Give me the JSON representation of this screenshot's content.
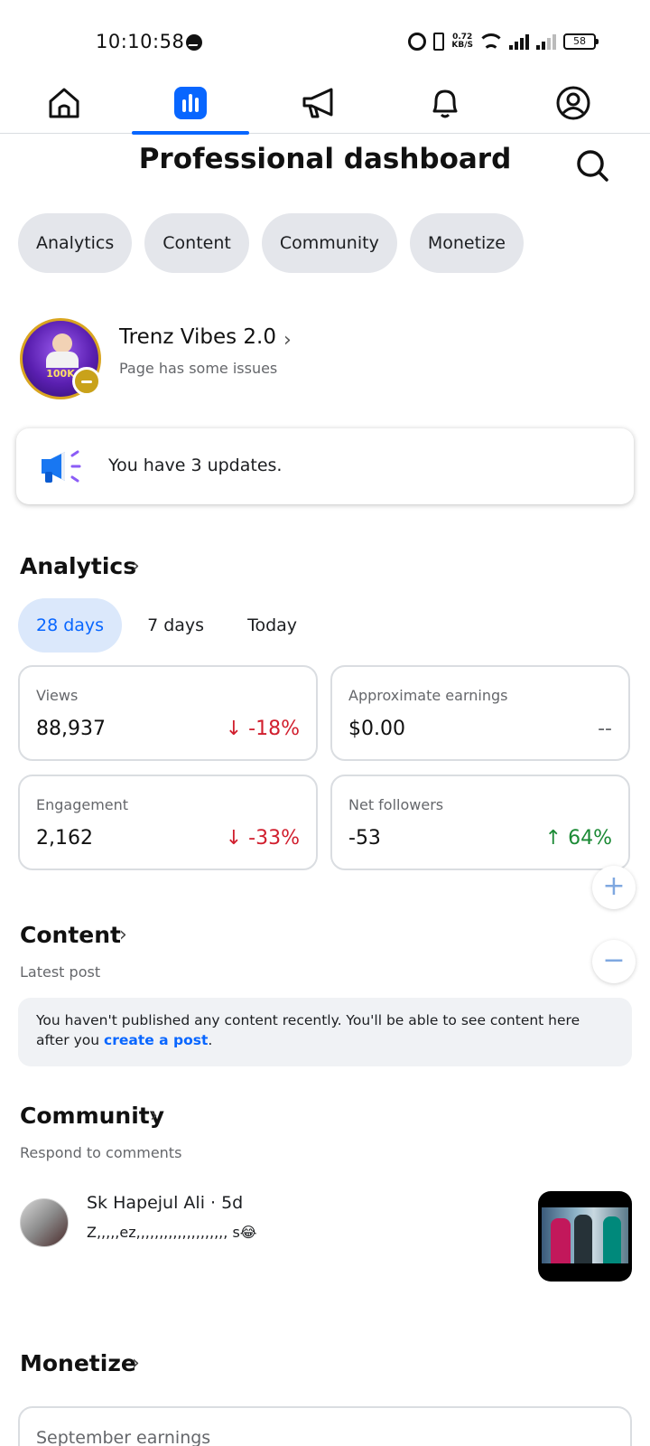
{
  "status_bar": {
    "time": "10:10:58",
    "speed_value": "0.72",
    "speed_unit": "KB/S",
    "battery": "58"
  },
  "nav": {
    "items": [
      "home-icon",
      "dashboard-icon",
      "megaphone-icon",
      "bell-icon",
      "profile-icon"
    ],
    "active_index": 1,
    "accent": "#0866ff"
  },
  "header": {
    "title": "Professional dashboard"
  },
  "chips": [
    "Analytics",
    "Content",
    "Community",
    "Monetize"
  ],
  "profile": {
    "name": "Trenz Vibes 2.0",
    "status": "Page has some issues",
    "avatar_badge": "100K"
  },
  "updates": {
    "text": "You have 3 updates."
  },
  "analytics": {
    "title": "Analytics",
    "ranges": [
      "28 days",
      "7 days",
      "Today"
    ],
    "selected_range": "28 days",
    "metrics": [
      {
        "label": "Views",
        "value": "88,937",
        "change": "↓ -18%",
        "trend": "down"
      },
      {
        "label": "Approximate earnings",
        "value": "$0.00",
        "change": "--",
        "trend": "neutral"
      },
      {
        "label": "Engagement",
        "value": "2,162",
        "change": "↓ -33%",
        "trend": "down"
      },
      {
        "label": "Net followers",
        "value": "-53",
        "change": "↑ 64%",
        "trend": "up"
      }
    ]
  },
  "zoom": {
    "plus": "+",
    "minus": "−"
  },
  "content": {
    "title": "Content",
    "subtitle": "Latest post",
    "message": "You haven't published any content recently. You'll be able to see content here after you",
    "link": "create a post",
    "end": "."
  },
  "community": {
    "title": "Community",
    "subtitle": "Respond to comments",
    "comment_author": "Sk Hapejul Ali · 5d",
    "comment_text": "Z,,,,,ez,,,,,,,,,,,,,,,,,,,, s😂"
  },
  "monetize": {
    "title": "Monetize",
    "card_label": "September earnings"
  }
}
